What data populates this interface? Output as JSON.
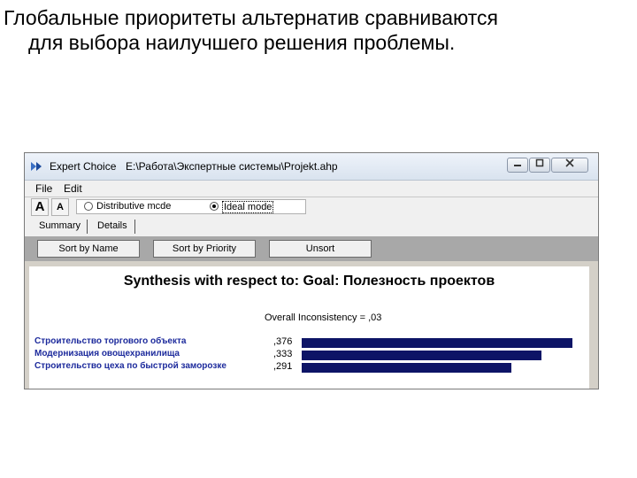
{
  "slide": {
    "title_line1": "Глобальные приоритеты альтернатив сравниваются",
    "title_line2": "для выбора наилучшего решения проблемы."
  },
  "window": {
    "app_name": "Expert Choice",
    "file_path": "E:\\Работа\\Экспертные системы\\Projekt.ahp",
    "icons": {
      "app": "expert-choice-logo-icon",
      "minimize": "minimize-icon",
      "maximize": "maximize-icon",
      "close": "close-icon"
    }
  },
  "menu": {
    "file": "File",
    "edit": "Edit"
  },
  "toolbar": {
    "font_increase": "A",
    "font_decrease": "A",
    "distributive_label": "Distributive mcde",
    "ideal_label": "Ideal mode",
    "selected_mode": "Ideal mode"
  },
  "tabs": {
    "summary": "Summary",
    "details": "Details"
  },
  "sort_buttons": {
    "by_name": "Sort by Name",
    "by_priority": "Sort by Priority",
    "unsort": "Unsort"
  },
  "synthesis": {
    "title": "Synthesis with respect to: Goal: Полезность проектов",
    "inconsistency": "Overall Inconsistency = ,03",
    "bar_color": "#0d1466",
    "alternatives": [
      {
        "name": "Строительство торгового объекта",
        "value": ",376",
        "priority": 0.376
      },
      {
        "name": "Модернизация овощехранилища",
        "value": ",333",
        "priority": 0.333
      },
      {
        "name": "Строительство цеха по быстрой заморозке",
        "value": ",291",
        "priority": 0.291
      }
    ]
  }
}
